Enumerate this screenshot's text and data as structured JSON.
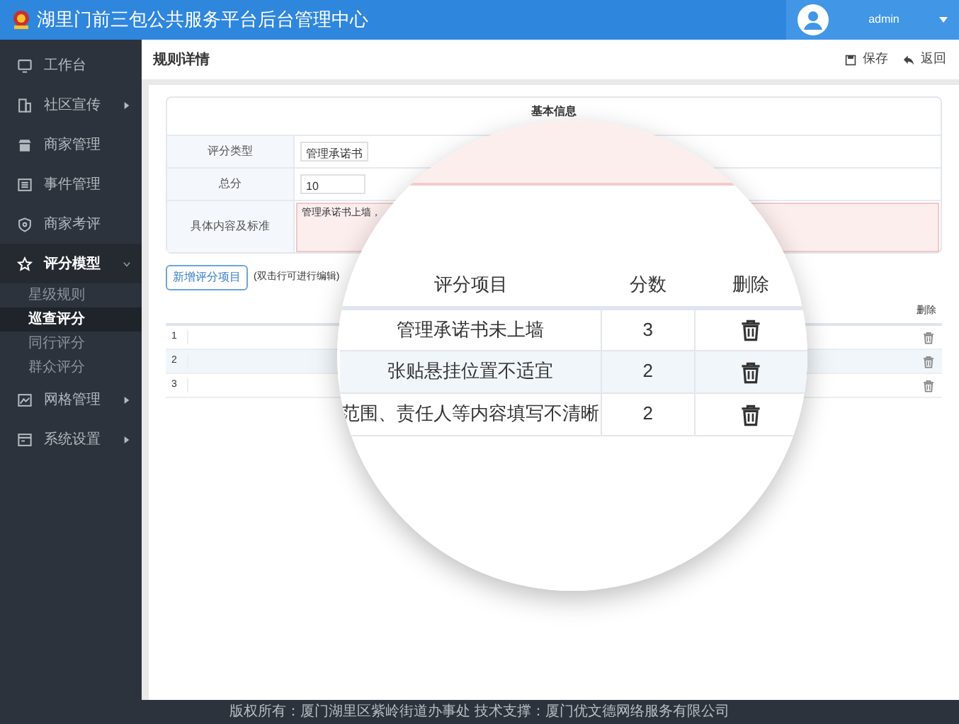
{
  "app": {
    "title": "湖里门前三包公共服务平台后台管理中心",
    "user": "admin"
  },
  "sidebar": {
    "items": [
      {
        "label": "工作台",
        "kind": "monitor",
        "selected": false
      },
      {
        "label": "社区宣传",
        "kind": "building",
        "selected": false,
        "expanded": false
      },
      {
        "label": "商家管理",
        "kind": "store",
        "selected": false
      },
      {
        "label": "事件管理",
        "kind": "list",
        "selected": false
      },
      {
        "label": "商家考评",
        "kind": "shield",
        "selected": false
      },
      {
        "label": "评分模型",
        "kind": "star",
        "selected": true,
        "expanded": true,
        "children": [
          {
            "label": "星级规则",
            "selected": false
          },
          {
            "label": "巡查评分",
            "selected": true
          },
          {
            "label": "同行评分",
            "selected": false
          },
          {
            "label": "群众评分",
            "selected": false
          }
        ]
      },
      {
        "label": "网格管理",
        "kind": "map",
        "selected": false,
        "expanded": false
      },
      {
        "label": "系统设置",
        "kind": "window",
        "selected": false,
        "expanded": false
      }
    ]
  },
  "page": {
    "title": "规则详情",
    "actions": [
      {
        "label": "保存",
        "kind": "save"
      },
      {
        "label": "返回",
        "kind": "back"
      }
    ]
  },
  "basic_info": {
    "title": "基本信息",
    "fields": [
      {
        "label": "评分类型",
        "value": "管理承诺书",
        "kind": "input"
      },
      {
        "label": "总分",
        "value": "10",
        "kind": "input"
      },
      {
        "label": "具体内容及标准",
        "value": "管理承诺书上墙，",
        "kind": "textarea"
      }
    ]
  },
  "add_button": "新增评分项目",
  "hint": "(双击行可进行编辑)",
  "table": {
    "columns": [
      "删除"
    ],
    "rows": [
      {
        "index": "1",
        "selected": false
      },
      {
        "index": "2",
        "selected": true
      },
      {
        "index": "3",
        "selected": false
      }
    ]
  },
  "magnifier": {
    "columns": [
      "评分项目",
      "分数",
      "删除"
    ],
    "rows": [
      {
        "item": "管理承诺书未上墙",
        "score": "3",
        "selected": false
      },
      {
        "item": "张贴悬挂位置不适宜",
        "score": "2",
        "selected": true
      },
      {
        "item": "范围、责任人等内容填写不清晰",
        "score": "2",
        "selected": false
      }
    ]
  },
  "footer": "版权所有：厦门湖里区紫岭街道办事处 技术支撑：厦门优文德网络服务有限公司"
}
